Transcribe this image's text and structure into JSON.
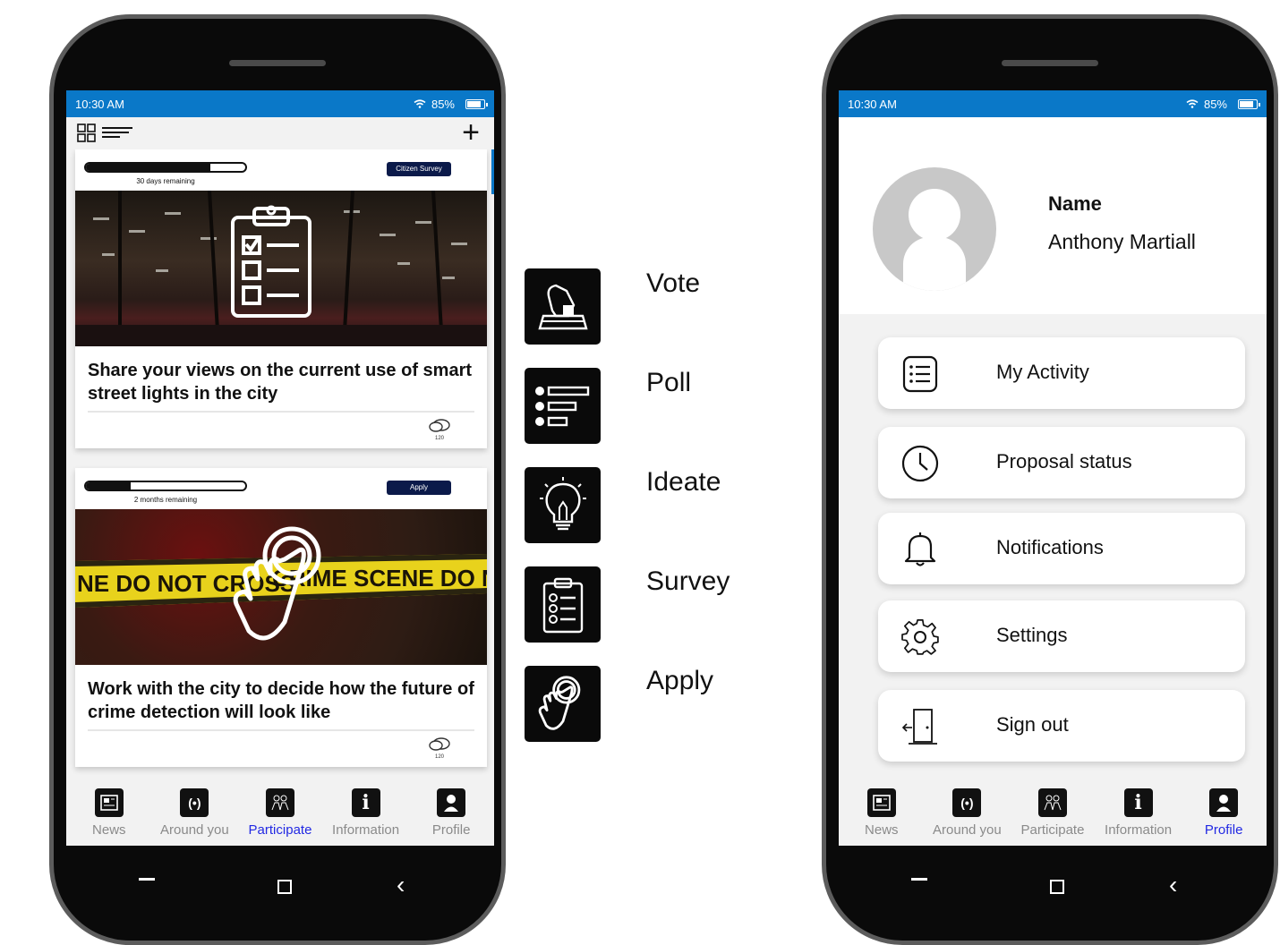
{
  "status_bar": {
    "time": "10:30 AM",
    "battery": "85%",
    "battery_level": 0.85
  },
  "feed": {
    "cards": [
      {
        "remaining": "30 days remaining",
        "progress": 0.78,
        "tag": "Citizen Survey",
        "title": "Share your views on the current use of smart street lights in the city",
        "comments": "120",
        "image_icon": "clipboard-checklist-icon"
      },
      {
        "remaining": "2 months remaining",
        "progress": 0.28,
        "tag": "Apply",
        "title": "Work with the city to decide how the future of crime detection will look like",
        "comments": "120",
        "image_icon": "hand-tap-icon"
      }
    ]
  },
  "legend": [
    {
      "label": "Vote",
      "icon": "ballot-box-icon"
    },
    {
      "label": "Poll",
      "icon": "poll-list-icon"
    },
    {
      "label": "Ideate",
      "icon": "lightbulb-icon"
    },
    {
      "label": "Survey",
      "icon": "survey-clipboard-icon"
    },
    {
      "label": "Apply",
      "icon": "hand-tap-icon"
    }
  ],
  "nav": {
    "left_active": "Participate",
    "right_active": "Profile",
    "items": [
      {
        "label": "News",
        "icon": "news-icon"
      },
      {
        "label": "Around you",
        "icon": "broadcast-icon"
      },
      {
        "label": "Participate",
        "icon": "people-icon"
      },
      {
        "label": "Information",
        "icon": "info-icon"
      },
      {
        "label": "Profile",
        "icon": "person-icon"
      }
    ]
  },
  "profile": {
    "name_label": "Name",
    "name_value": "Anthony Martiall",
    "menu": [
      {
        "label": "My Activity",
        "icon": "list-icon"
      },
      {
        "label": "Proposal status",
        "icon": "clock-icon"
      },
      {
        "label": "Notifications",
        "icon": "bell-icon"
      },
      {
        "label": "Settings",
        "icon": "gear-icon"
      },
      {
        "label": "Sign out",
        "icon": "door-exit-icon"
      }
    ]
  },
  "colors": {
    "status_bar": "#0a78c8",
    "active_nav": "#2229e3",
    "tag_bg": "#0b1a4a"
  }
}
